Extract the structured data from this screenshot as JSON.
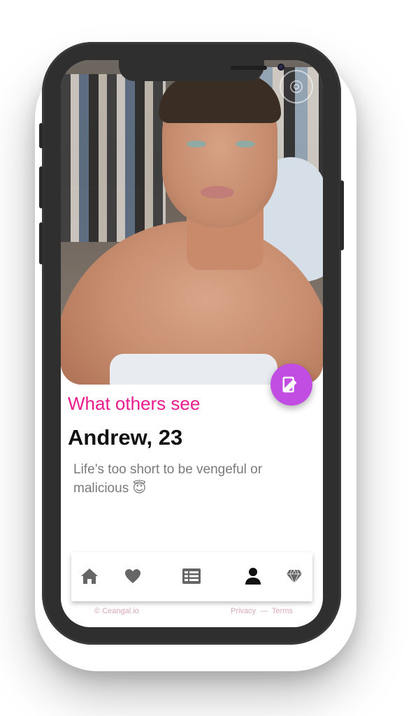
{
  "profile": {
    "section_title": "What others see",
    "name_age": "Andrew, 23",
    "bio": "Life’s too short to be vengeful or malicious 😇"
  },
  "tabs": [
    {
      "icon": "home-icon"
    },
    {
      "icon": "heart-icon"
    },
    {
      "icon": "news-icon"
    },
    {
      "icon": "person-icon",
      "active": true
    },
    {
      "icon": "diamond-icon"
    }
  ],
  "footer": {
    "copyright": "© Ceangal.io",
    "privacy": "Privacy",
    "separator": "—",
    "terms": "Terms"
  },
  "colors": {
    "accent_pink": "#ec1b8c",
    "fab_purple": "#c24de2",
    "tab_active": "#111111",
    "tab_inactive": "#666666"
  }
}
